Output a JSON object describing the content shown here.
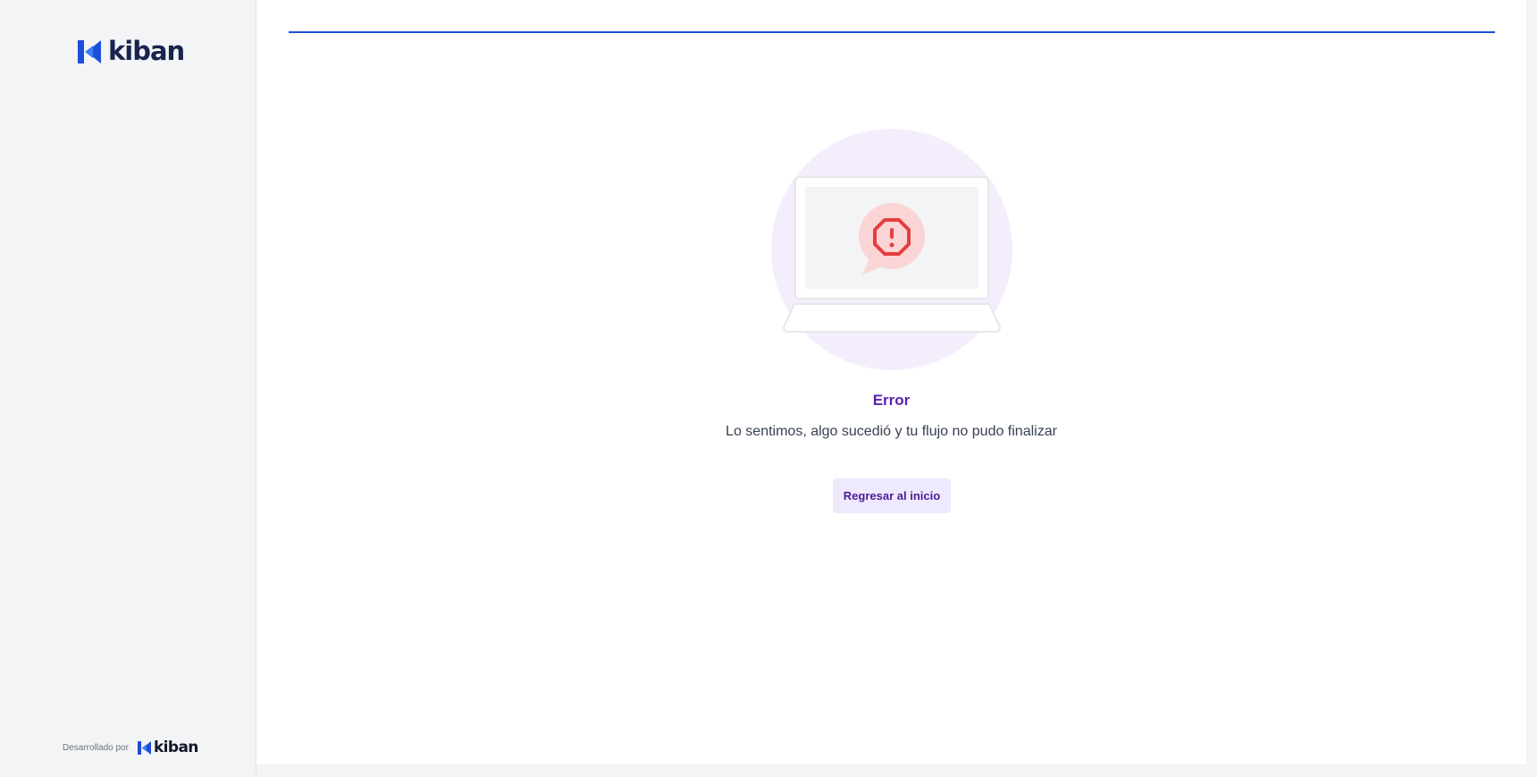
{
  "brand": {
    "name": "kiban",
    "color": "#1d4ed8",
    "text_color": "#17244d"
  },
  "footer": {
    "powered_by": "Desarrollado por",
    "brand": "kiban"
  },
  "progress": {
    "value": 1.0,
    "color": "#1d4ed8"
  },
  "error": {
    "icon": "stop-alert-icon",
    "title": "Error",
    "message": "Lo sentimos, algo sucedió y tu flujo no pudo finalizar",
    "button_label": "Regresar al inicio"
  },
  "colors": {
    "accent": "#5b21b6",
    "alert": "#ef4444"
  }
}
